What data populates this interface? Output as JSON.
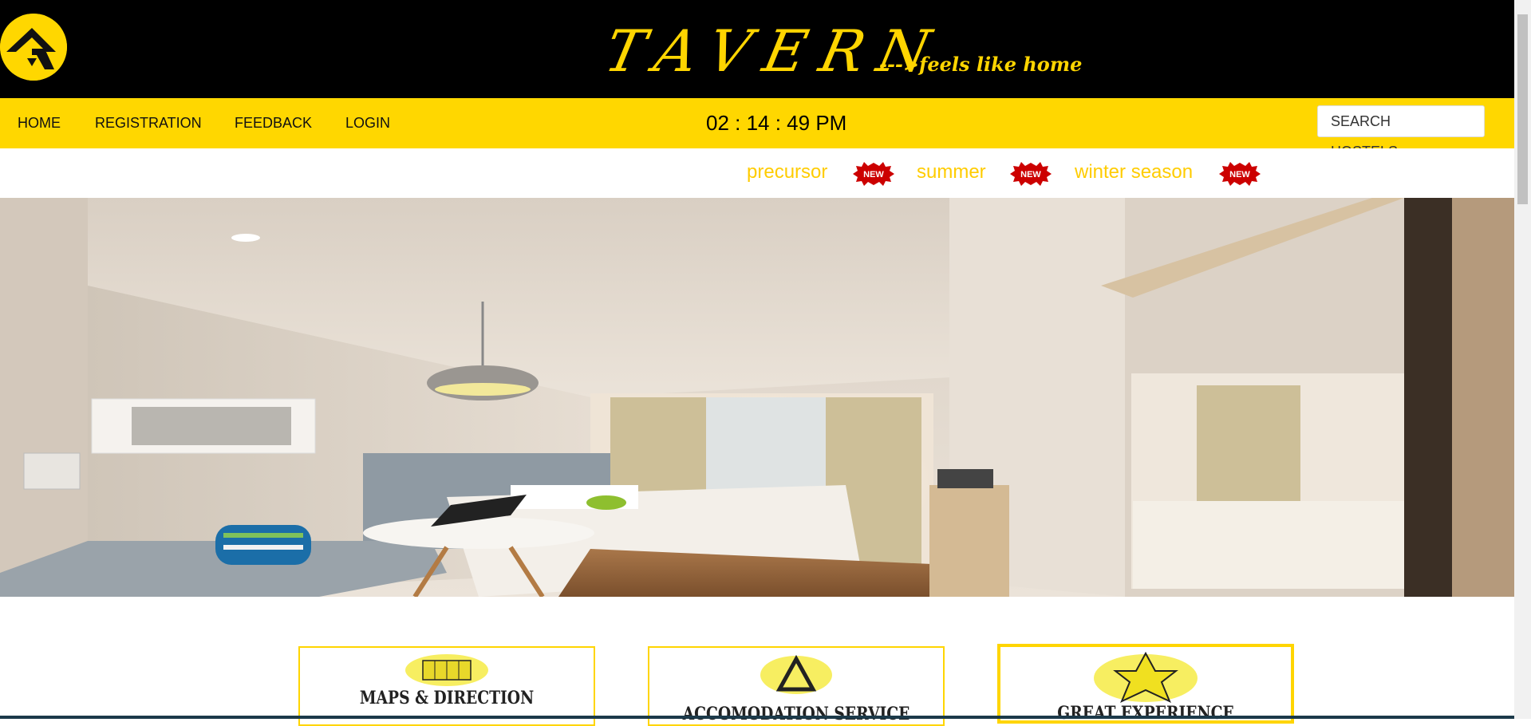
{
  "header": {
    "brand": "TAVERN",
    "tagline": "--->feels like home"
  },
  "nav": {
    "items": [
      {
        "label": "HOME"
      },
      {
        "label": "REGISTRATION"
      },
      {
        "label": "FEEDBACK"
      },
      {
        "label": "LOGIN"
      }
    ],
    "clock": "02 : 14 : 49 PM",
    "search_label": "SEARCH HOSTELS...."
  },
  "news": {
    "items": [
      {
        "text": "precursor",
        "badge": "NEW"
      },
      {
        "text": "summer",
        "badge": "NEW"
      },
      {
        "text": "winter season",
        "badge": "NEW"
      }
    ]
  },
  "features": [
    {
      "title": "MAPS & DIRECTION",
      "icon": "map-icon"
    },
    {
      "title": "ACCOMODATION SERVICE",
      "icon": "triangle-icon"
    },
    {
      "title": "GREAT EXPERIENCE",
      "icon": "star-icon"
    }
  ],
  "colors": {
    "brand_yellow": "#ffd700",
    "header_black": "#000000",
    "news_text": "#ffcc00",
    "badge_red": "#cc0000"
  }
}
